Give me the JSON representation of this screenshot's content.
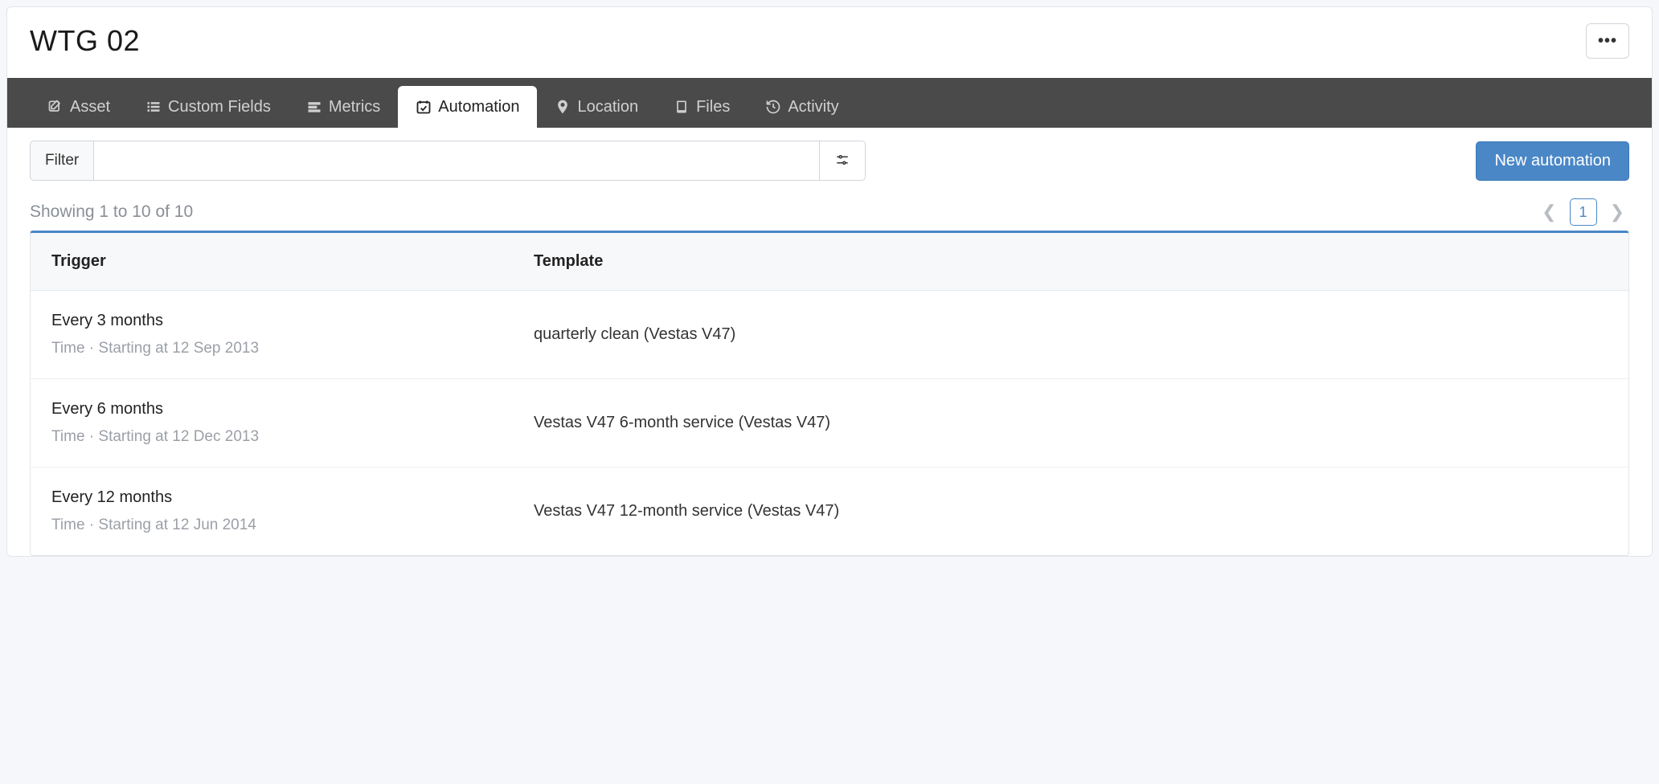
{
  "header": {
    "title": "WTG 02"
  },
  "tabs": [
    {
      "id": "asset",
      "label": "Asset",
      "icon": "edit-icon",
      "active": false
    },
    {
      "id": "custom-fields",
      "label": "Custom Fields",
      "icon": "list-icon",
      "active": false
    },
    {
      "id": "metrics",
      "label": "Metrics",
      "icon": "bars-icon",
      "active": false
    },
    {
      "id": "automation",
      "label": "Automation",
      "icon": "calendar-check-icon",
      "active": true
    },
    {
      "id": "location",
      "label": "Location",
      "icon": "pin-icon",
      "active": false
    },
    {
      "id": "files",
      "label": "Files",
      "icon": "book-icon",
      "active": false
    },
    {
      "id": "activity",
      "label": "Activity",
      "icon": "history-icon",
      "active": false
    }
  ],
  "toolbar": {
    "filter_label": "Filter",
    "filter_value": "",
    "new_automation_label": "New automation"
  },
  "list": {
    "showing_text": "Showing 1 to 10 of 10",
    "page": "1",
    "columns": {
      "trigger": "Trigger",
      "template": "Template"
    },
    "rows": [
      {
        "trigger_title": "Every 3 months",
        "trigger_sub": "Time  ·  Starting at 12 Sep 2013",
        "template": "quarterly clean (Vestas V47)"
      },
      {
        "trigger_title": "Every 6 months",
        "trigger_sub": "Time  ·  Starting at 12 Dec 2013",
        "template": "Vestas V47 6-month service (Vestas V47)"
      },
      {
        "trigger_title": "Every 12 months",
        "trigger_sub": "Time  ·  Starting at 12 Jun 2014",
        "template": "Vestas V47 12-month service (Vestas V47)"
      }
    ]
  }
}
